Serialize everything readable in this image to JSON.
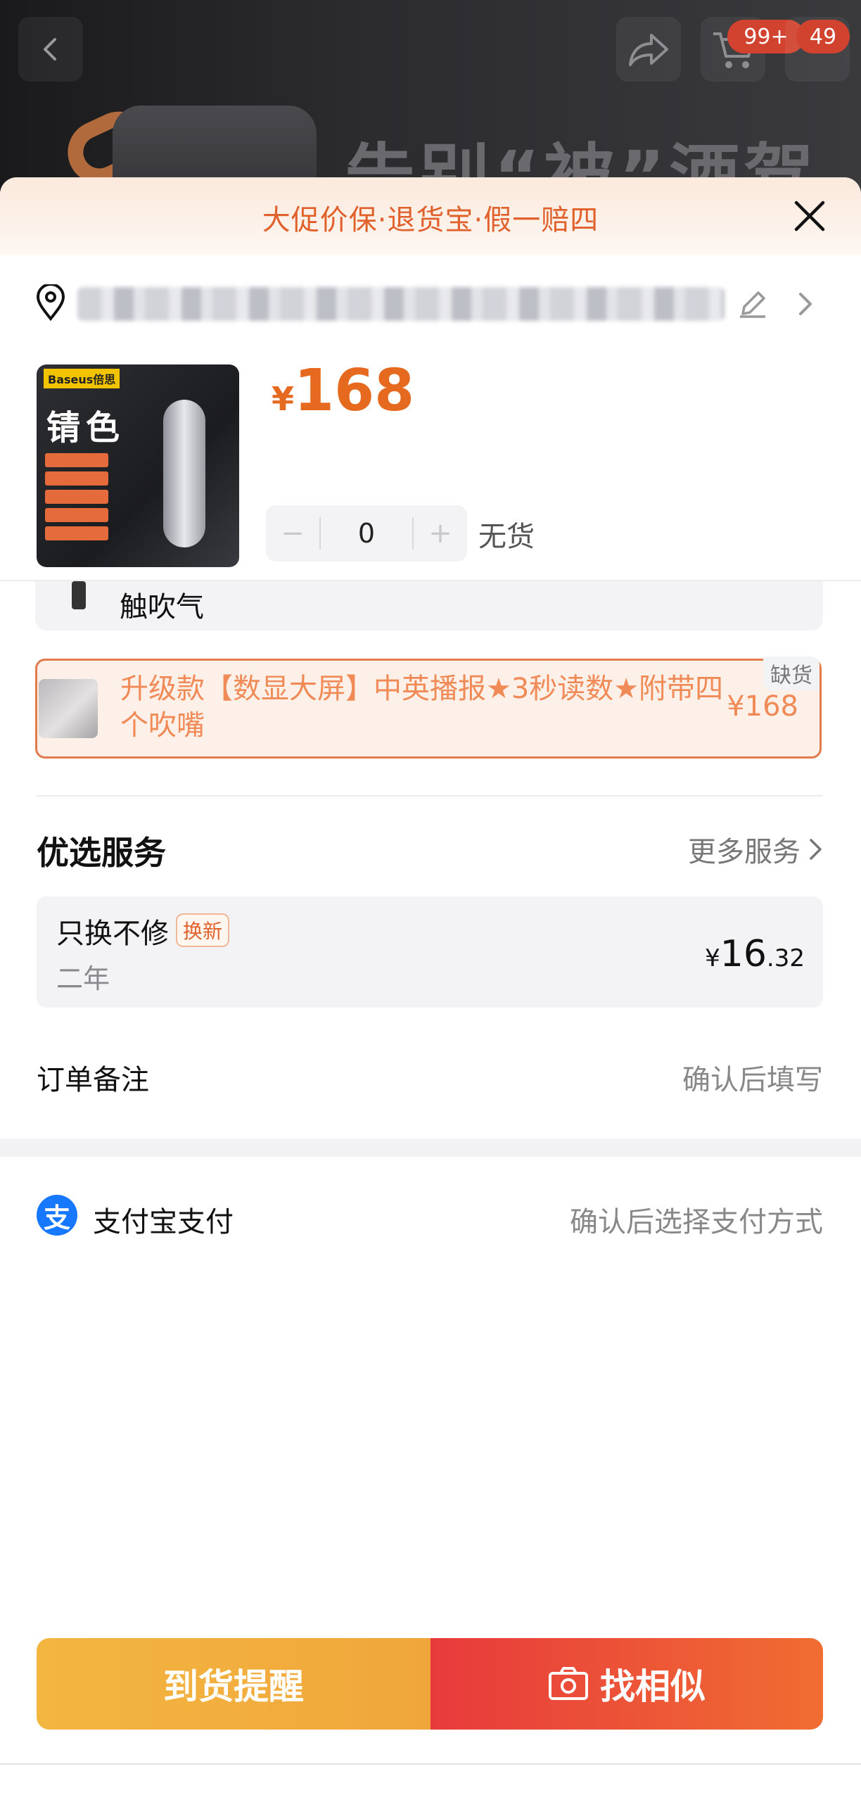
{
  "banner": {
    "headline": "告别“被”酒驾",
    "cart_badge": "99+",
    "more_badge": "49"
  },
  "sheet": {
    "promo": "大促价保·退货宝·假一赔四",
    "product": {
      "thumb_brand": "Baseus倍思",
      "thumb_title": "锖色",
      "price_currency": "¥",
      "price": "168",
      "quantity": "0",
      "stock_status": "无货",
      "stepper_minus": "−",
      "stepper_plus": "+"
    },
    "previous_option_label": "触吹气",
    "selected_option": {
      "text": "升级款【数显大屏】中英播报★3秒读数★附带四个吹嘴",
      "price": "¥168",
      "tag": "缺货"
    },
    "services": {
      "title": "优选服务",
      "more": "更多服务",
      "card": {
        "name": "只换不修",
        "tag": "换新",
        "sub": "二年",
        "price_currency": "¥",
        "price_int": "16",
        "price_dec": ".32"
      }
    },
    "order_note": {
      "label": "订单备注",
      "value": "确认后填写"
    },
    "payment": {
      "icon_char": "支",
      "label": "支付宝支付",
      "value": "确认后选择支付方式"
    },
    "actions": {
      "notify": "到货提醒",
      "similar": "找相似"
    }
  },
  "colors": {
    "accent_orange": "#e56a20",
    "button_yellow": "#f3b640",
    "button_red": "#e83a3c",
    "alipay_blue": "#1677ff"
  },
  "icons": [
    "back-icon",
    "share-icon",
    "cart-icon",
    "more-icon",
    "close-icon",
    "location-icon",
    "edit-icon",
    "chevron-right-icon",
    "camera-icon",
    "alipay-icon"
  ]
}
